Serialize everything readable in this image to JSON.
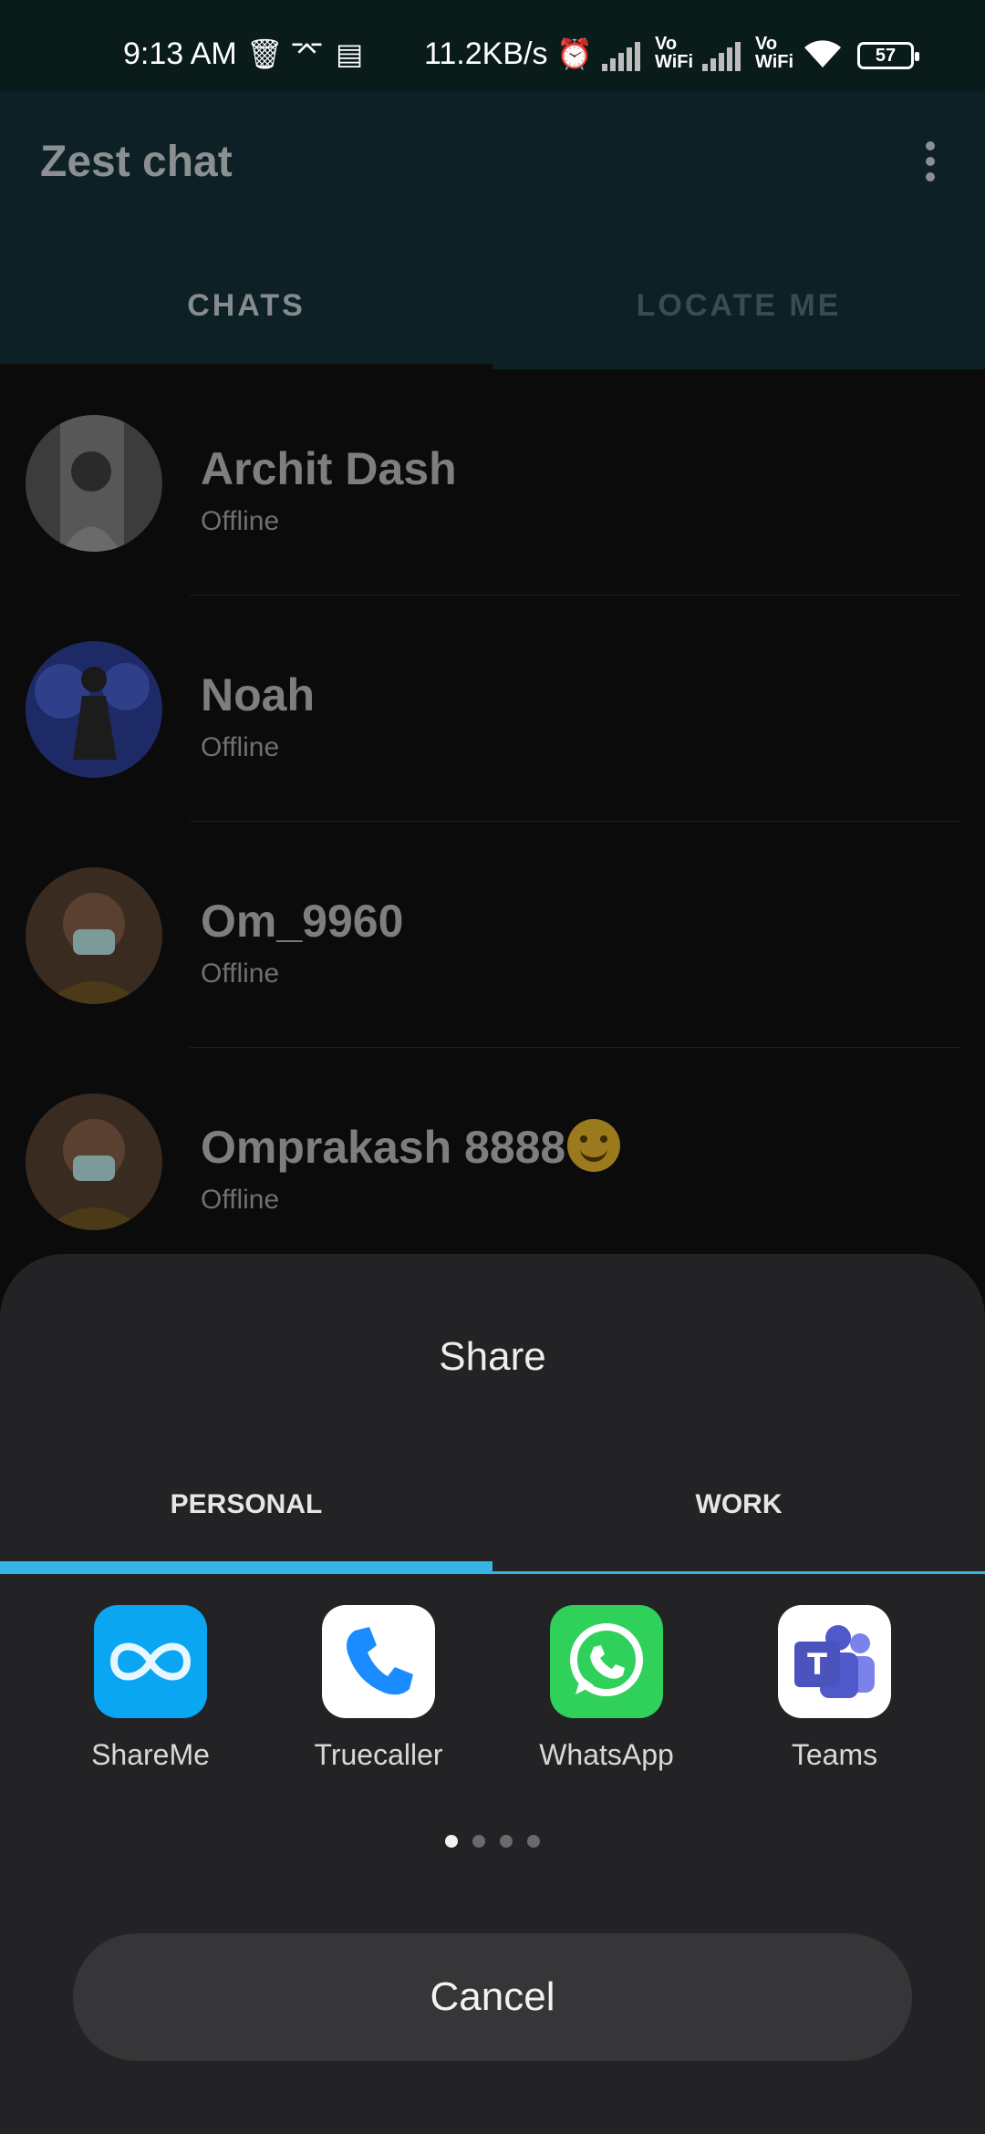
{
  "status_bar": {
    "time": "9:13 AM",
    "net_speed": "11.2KB/s",
    "vowifi_1": "Vo\nWiFi",
    "vowifi_2": "Vo\nWiFi",
    "battery": "57"
  },
  "app": {
    "title": "Zest chat",
    "tabs": [
      {
        "label": "CHATS",
        "active": true
      },
      {
        "label": "LOCATE ME",
        "active": false
      }
    ]
  },
  "chats": [
    {
      "name": "Archit Dash",
      "status": "Offline"
    },
    {
      "name": "Noah",
      "status": "Offline"
    },
    {
      "name": "Om_9960",
      "status": "Offline"
    },
    {
      "name": "Omprakash 8888",
      "status": "Offline"
    }
  ],
  "share_sheet": {
    "title": "Share",
    "tabs": [
      {
        "label": "PERSONAL",
        "active": true
      },
      {
        "label": "WORK",
        "active": false
      }
    ],
    "apps": [
      {
        "label": "ShareMe",
        "icon": "shareme-icon",
        "color": "#0aa6f2"
      },
      {
        "label": "Truecaller",
        "icon": "truecaller-icon",
        "color": "#ffffff"
      },
      {
        "label": "WhatsApp",
        "icon": "whatsapp-icon",
        "color": "#2fd15a"
      },
      {
        "label": "Teams",
        "icon": "teams-icon",
        "color": "#ffffff"
      }
    ],
    "page_count": 4,
    "current_page": 1,
    "cancel_label": "Cancel"
  },
  "colors": {
    "accent": "#35b4e6",
    "sheet_bg": "#232325"
  }
}
